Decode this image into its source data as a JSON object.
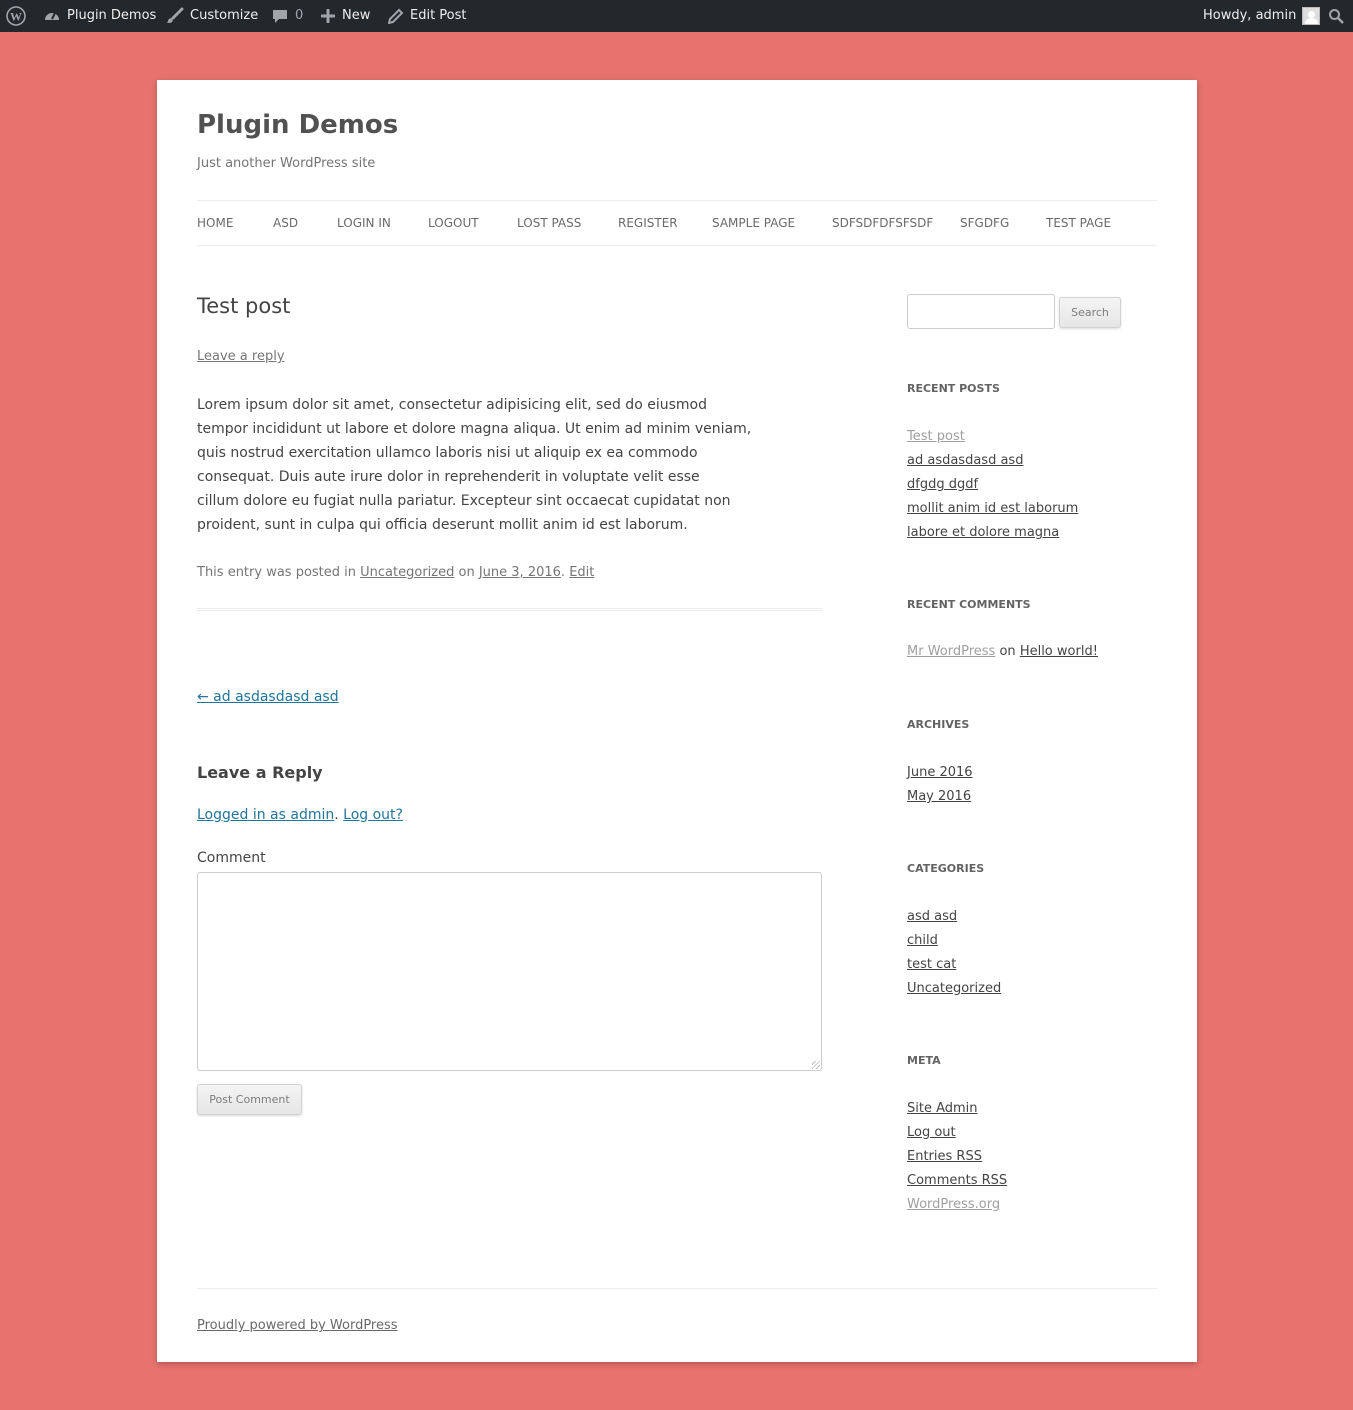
{
  "adminbar": {
    "site_name": "Plugin Demos",
    "customize": "Customize",
    "comments_count": "0",
    "new": "New",
    "edit_post": "Edit Post",
    "howdy": "Howdy, admin"
  },
  "site": {
    "title": "Plugin Demos",
    "description": "Just another WordPress site"
  },
  "nav": [
    "HOME",
    "ASD",
    "LOGIN IN",
    "LOGOUT",
    "LOST PASS",
    "REGISTER",
    "SAMPLE PAGE",
    "SDFSDFDFSFSDF",
    "SFGDFG",
    "TEST PAGE"
  ],
  "post": {
    "title": "Test post",
    "leave_reply": "Leave a reply",
    "paragraph_lines": [
      "Lorem ipsum dolor sit amet, consectetur adipisicing elit, sed do eiusmod",
      "tempor incididunt ut labore et dolore magna aliqua. Ut enim ad minim veniam,",
      "quis nostrud exercitation ullamco laboris nisi ut aliquip ex ea commodo",
      "consequat. Duis aute irure dolor in reprehenderit in voluptate velit esse",
      "cillum dolore eu fugiat nulla pariatur. Excepteur sint occaecat cupidatat non",
      "proident, sunt in culpa qui officia deserunt mollit anim id est laborum."
    ],
    "meta_prefix": "This entry was posted in",
    "meta_category": "Uncategorized",
    "meta_on": "on",
    "meta_date": "June 3, 2016",
    "meta_edit": "Edit"
  },
  "post_nav": {
    "prev": "← ad asdasdasd asd"
  },
  "comment_form": {
    "title": "Leave a Reply",
    "logged_in_as": "Logged in as admin",
    "logout": "Log out?",
    "comment_label": "Comment",
    "submit": "Post Comment"
  },
  "sidebar": {
    "search_button": "Search",
    "recent_posts_title": "RECENT POSTS",
    "recent_posts": [
      "Test post",
      "ad asdasdasd asd",
      "dfgdg dgdf",
      "mollit anim id est laborum",
      "labore et dolore magna"
    ],
    "recent_comments_title": "RECENT COMMENTS",
    "recent_comment_author": "Mr WordPress",
    "recent_comment_on": "on",
    "recent_comment_post": "Hello world!",
    "archives_title": "ARCHIVES",
    "archives": [
      "June 2016",
      "May 2016"
    ],
    "categories_title": "CATEGORIES",
    "categories": [
      "asd asd",
      "child",
      "test cat",
      "Uncategorized"
    ],
    "meta_title": "META",
    "meta": [
      "Site Admin",
      "Log out",
      "Entries RSS",
      "Comments RSS",
      "WordPress.org"
    ]
  },
  "footer": {
    "powered": "Proudly powered by WordPress"
  },
  "colors": {
    "background": "#e8736e",
    "adminbar": "#23282d",
    "link_blue": "#21759b"
  }
}
